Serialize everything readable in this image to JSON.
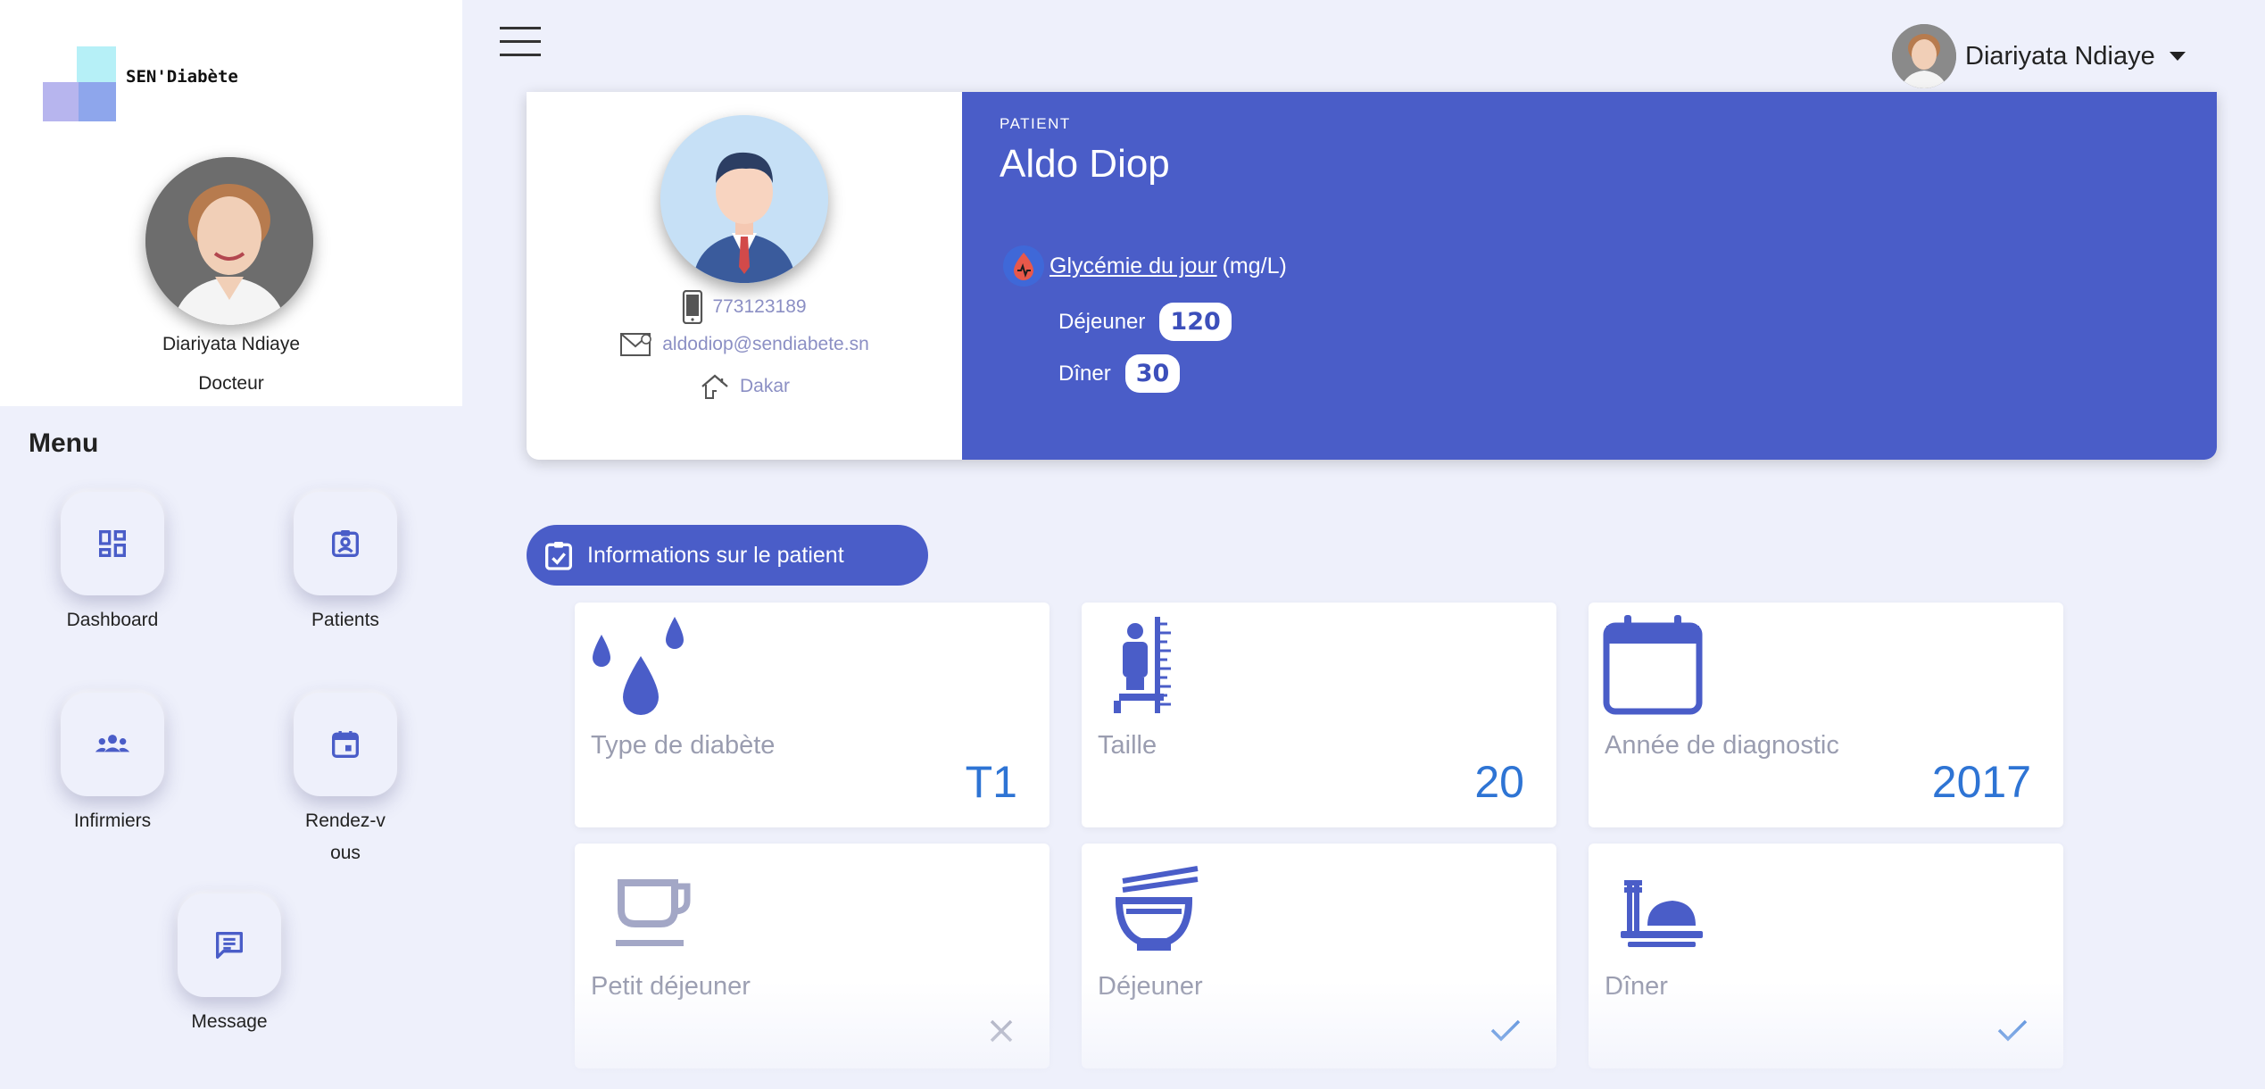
{
  "app": {
    "logo_text": "SEN'Diabète"
  },
  "sidebar": {
    "user_name": "Diariyata Ndiaye",
    "user_role": "Docteur",
    "menu_title": "Menu",
    "items": [
      {
        "label": "Dashboard",
        "icon": "dashboard-icon"
      },
      {
        "label": "Patients",
        "icon": "patient-badge-icon"
      },
      {
        "label": "Infirmiers",
        "icon": "group-icon"
      },
      {
        "label": "Rendez-vous",
        "icon": "calendar-icon"
      },
      {
        "label": "Message",
        "icon": "message-icon"
      }
    ]
  },
  "header": {
    "user_name": "Diariyata Ndiaye"
  },
  "patient": {
    "label": "PATIENT",
    "name": "Aldo Diop",
    "phone": "773123189",
    "email": "aldodiop@sendiabete.sn",
    "city": "Dakar",
    "glycemia": {
      "link": "Glycémie du jour",
      "unit": "(mg/L)",
      "lunch_label": "Déjeuner",
      "lunch_value": "120",
      "dinner_label": "Dîner",
      "dinner_value": "30"
    }
  },
  "section": {
    "title": "Informations sur le patient"
  },
  "info_cards": [
    {
      "label": "Type de diabète",
      "value": "T1",
      "icon": "drops-icon"
    },
    {
      "label": "Taille",
      "value": "20",
      "icon": "height-icon"
    },
    {
      "label": "Année de diagnostic",
      "value": "2017",
      "icon": "calendar-icon"
    },
    {
      "label": "Petit déjeuner",
      "value": "✕",
      "icon": "coffee-cup-icon",
      "status": "no"
    },
    {
      "label": "Déjeuner",
      "value": "✓",
      "icon": "bowl-icon",
      "status": "yes"
    },
    {
      "label": "Dîner",
      "value": "✓",
      "icon": "dinner-plate-icon",
      "status": "yes"
    }
  ],
  "colors": {
    "primary": "#4a5dc8",
    "background": "#eef0fb",
    "value_blue": "#2e74d4",
    "muted_label": "#9a9db0",
    "contact_text": "#8b8fc4"
  }
}
